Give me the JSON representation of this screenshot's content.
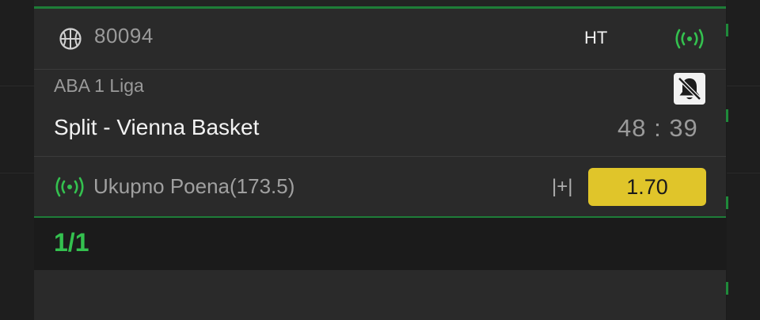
{
  "event": {
    "match_id": "80094",
    "status": "HT",
    "league": "ABA 1 Liga",
    "teams": "Split - Vienna Basket",
    "score": "48 : 39"
  },
  "market": {
    "label": "Ukupno Poena(173.5)",
    "more_label": "|+|",
    "odds": "1.70"
  },
  "pagination": {
    "label": "1/1"
  },
  "colors": {
    "accent_green": "#34c14f",
    "odds_yellow": "#e0c52a",
    "panel_bg": "#2a2a2a",
    "page_bg": "#1b1b1b"
  },
  "icons": [
    "basketball-icon",
    "live-signal-icon",
    "notification-off-icon"
  ]
}
